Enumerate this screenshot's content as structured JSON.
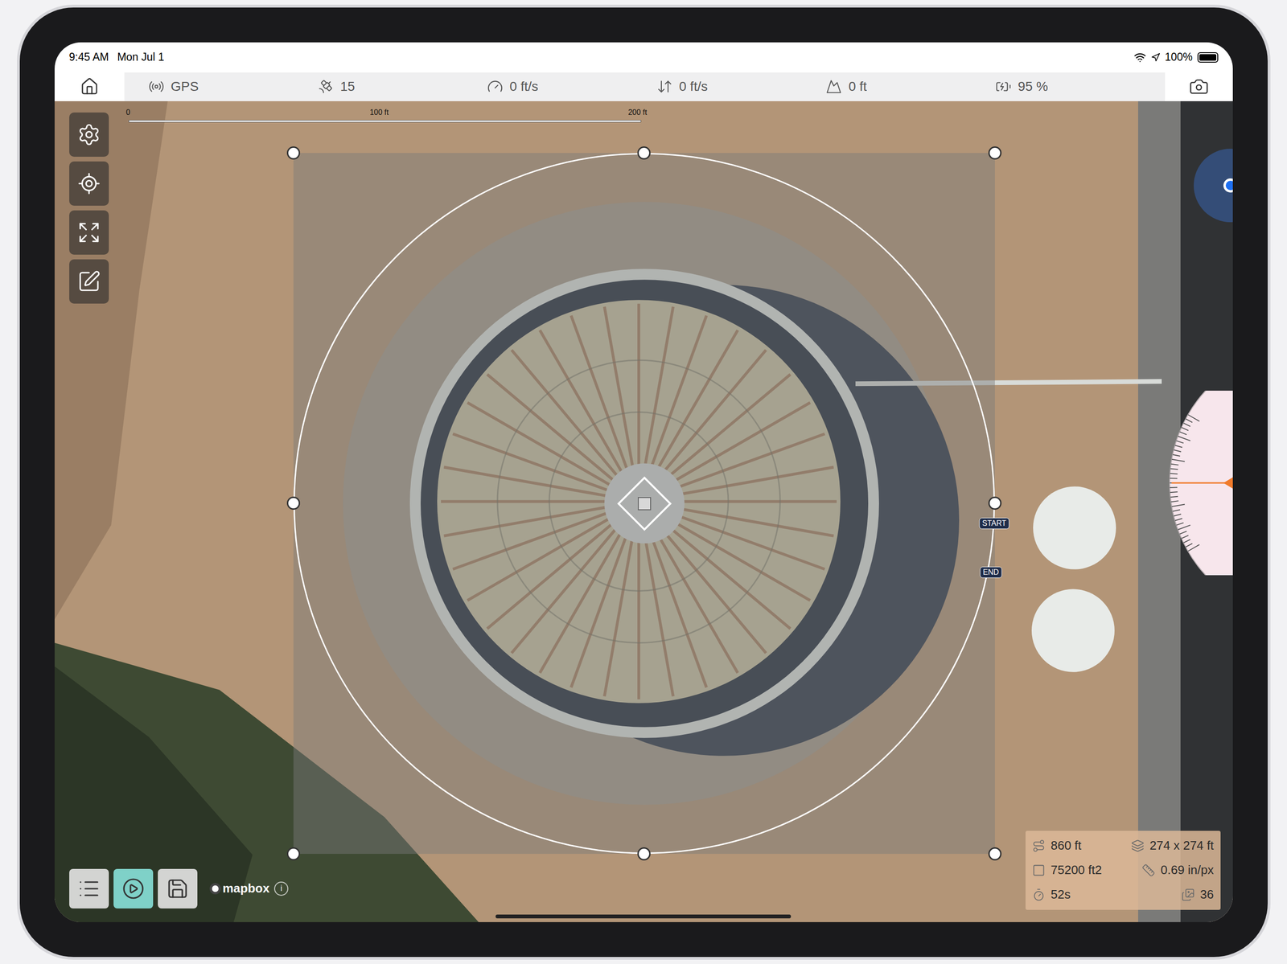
{
  "status_bar": {
    "time": "9:45 AM",
    "date": "Mon Jul 1",
    "battery": "100%",
    "battery_level": 1
  },
  "toolbar": {
    "items": [
      {
        "kind": "mode",
        "label": "GPS"
      },
      {
        "kind": "satellites",
        "label": "15"
      },
      {
        "kind": "h-speed",
        "label": "0 ft/s"
      },
      {
        "kind": "v-speed",
        "label": "0 ft/s"
      },
      {
        "kind": "altitude",
        "label": "0 ft"
      },
      {
        "kind": "battery",
        "label": "95 %"
      }
    ]
  },
  "scale_bar": {
    "ticks": [
      "0",
      "100 ft",
      "200 ft"
    ]
  },
  "map_tools": [
    {
      "kind": "settings"
    },
    {
      "kind": "locate"
    },
    {
      "kind": "expand"
    },
    {
      "kind": "edit"
    }
  ],
  "flight_path": {
    "start": "START",
    "end": "END"
  },
  "heading_dial": {
    "level": 0.5
  },
  "bottom_buttons": [
    {
      "kind": "list",
      "selected": false
    },
    {
      "kind": "play",
      "selected": true
    },
    {
      "kind": "save",
      "selected": false
    }
  ],
  "attribution": {
    "logo": "mapbox",
    "info": "i"
  },
  "stats": [
    {
      "kind": "distance",
      "value": "860 ft"
    },
    {
      "kind": "dimensions",
      "value": "274 x 274 ft"
    },
    {
      "kind": "area",
      "value": "75200 ft2"
    },
    {
      "kind": "resolution",
      "value": "0.69 in/px"
    },
    {
      "kind": "duration",
      "value": "52s"
    },
    {
      "kind": "photos",
      "value": "36"
    }
  ]
}
